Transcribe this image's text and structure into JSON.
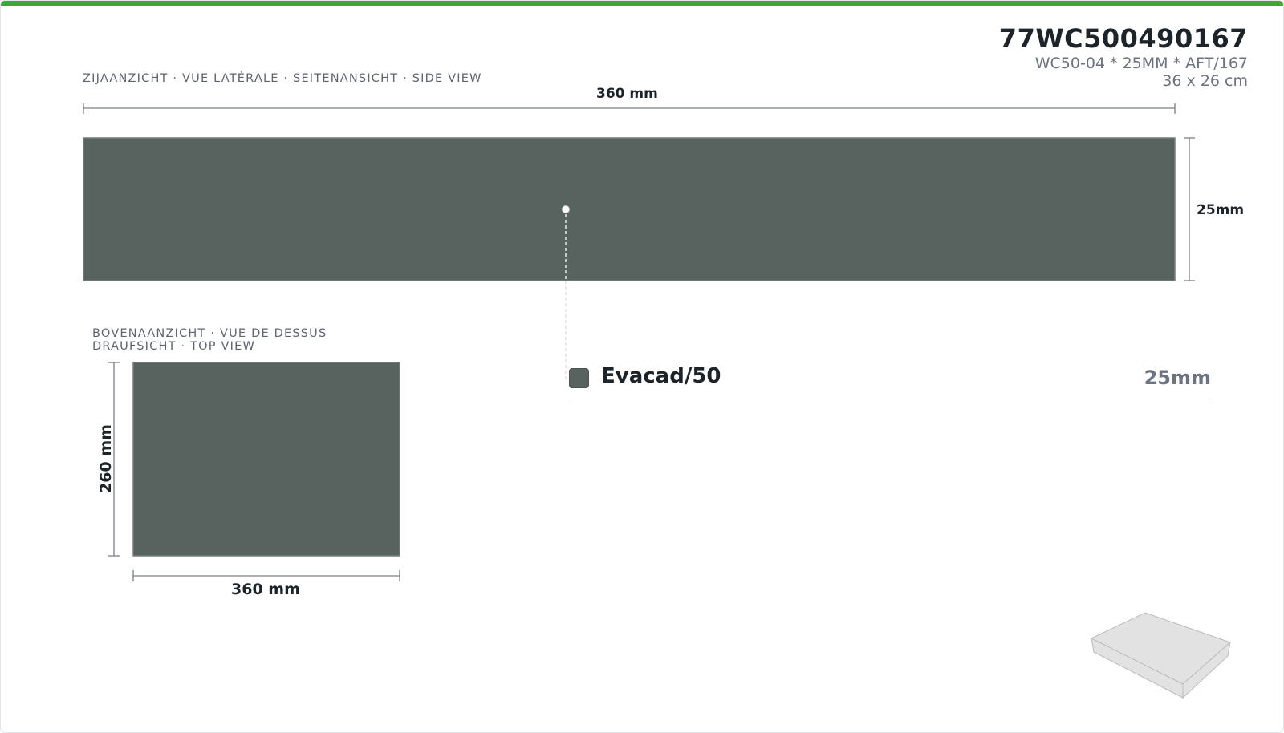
{
  "header": {
    "product_code": "77WC500490167",
    "description": "WC50-04 * 25MM * AFT/167",
    "size": "36 x 26 cm"
  },
  "side_view": {
    "title": "ZIJAANZICHT · VUE LATÉRALE · SEITENANSICHT · SIDE VIEW",
    "width_label": "360 mm",
    "height_label": "25mm"
  },
  "top_view": {
    "title_line1": "BOVENAANZICHT · VUE DE DESSUS",
    "title_line2": "DRAUFSICHT · TOP VIEW",
    "width_label": "360 mm",
    "height_label": "260 mm"
  },
  "legend": {
    "items": [
      {
        "name": "Evacad/50",
        "thickness": "25mm",
        "color": "#58635f"
      }
    ]
  },
  "colors": {
    "accent": "#3aa935",
    "material": "#58635f",
    "dimension_line": "#7a8089",
    "box_3d_fill": "#e2e2e2"
  },
  "icons": [
    "isometric-box-icon"
  ]
}
